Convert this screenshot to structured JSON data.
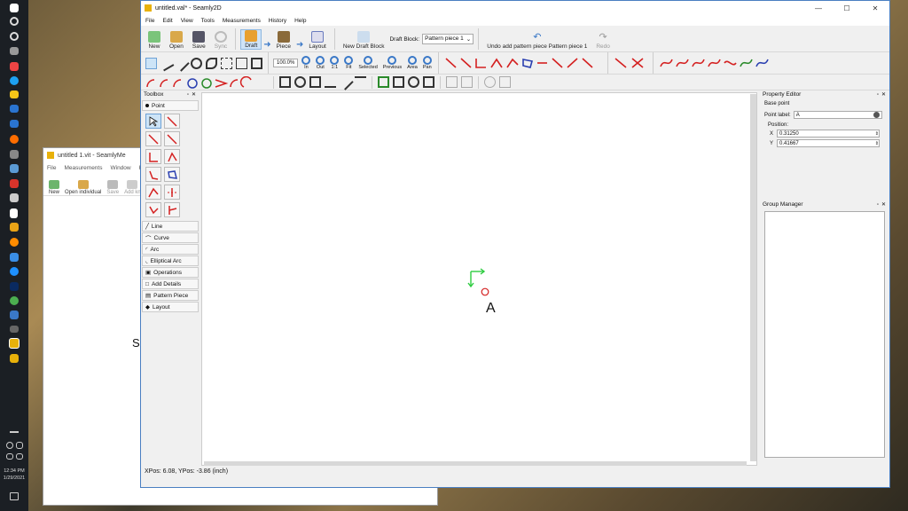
{
  "taskbar": {
    "clock_time": "12:34 PM",
    "clock_date": "1/29/2021"
  },
  "seamlyme": {
    "title": "untitled 1.vit - SeamlyMe",
    "menu": [
      "File",
      "Measurements",
      "Window",
      "H"
    ],
    "tools": [
      "New",
      "Open individual",
      "Save",
      "Add kn"
    ],
    "canvas_letter": "S"
  },
  "main": {
    "title": "untitled.val* - Seamly2D",
    "menu": [
      "File",
      "Edit",
      "View",
      "Tools",
      "Measurements",
      "History",
      "Help"
    ],
    "toolbar": {
      "new": "New",
      "open": "Open",
      "save": "Save",
      "sync": "Sync",
      "draft": "Draft",
      "piece": "Piece",
      "layout": "Layout",
      "new_draft_block": "New Draft Block",
      "draft_block_label": "Draft Block:",
      "draft_block_value": "Pattern piece 1",
      "undo": "Undo add pattern piece Pattern piece 1",
      "redo": "Redo"
    },
    "zoom": {
      "value": "100.0%",
      "labels": [
        "In",
        "Out",
        "1:1",
        "Fit",
        "Selected",
        "Previous",
        "Area",
        "Pan"
      ]
    },
    "toolbox": {
      "title": "Toolbox",
      "section": "Point",
      "categories": [
        "Line",
        "Curve",
        "Arc",
        "Elliptical Arc",
        "Operations",
        "Add Details",
        "Pattern Piece",
        "Layout"
      ]
    },
    "canvas": {
      "point_label": "A"
    },
    "status": "XPos: 6.08, YPos: -3.86 (inch)",
    "property_editor": {
      "title": "Property Editor",
      "section": "Base point",
      "point_label_label": "Point label:",
      "point_label_value": "A",
      "position_label": "Position:",
      "x_label": "X",
      "x_value": "0.31250",
      "y_label": "Y",
      "y_value": "0.41667"
    },
    "group_manager": {
      "title": "Group Manager"
    }
  },
  "colors": {
    "accent_blue": "#3a78c7",
    "tool_red": "#d42020",
    "axis_green": "#2ecc40"
  }
}
